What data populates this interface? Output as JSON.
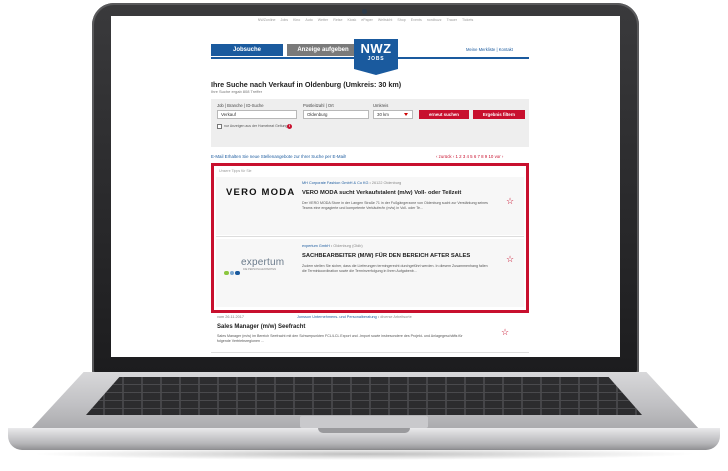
{
  "top_nav": [
    "NWZonline",
    "Jobs",
    "Kino",
    "Auto",
    "Wetter",
    "Reise",
    "Kiosk",
    "ePaper",
    "Weltsicht",
    "Shop",
    "Events",
    "nordbuzz",
    "Trauer",
    "Tickets"
  ],
  "header": {
    "jobsuche_label": "Jobsuche",
    "anzeige_label": "Anzeige aufgeben",
    "logo_main": "NWZ",
    "logo_sub": "JOBS",
    "merkliste_label": "Meine Merkliste | Kontakt"
  },
  "search": {
    "heading": "Ihre Suche nach Verkauf in Oldenburg (Umkreis: 30 km)",
    "subheading": "Ihre Suche ergab 808 Treffer",
    "job_label": "Job | Branche | ID-Suche",
    "job_value": "Verkauf",
    "location_label": "Postleitzahl | Ort",
    "location_value": "Oldenburg",
    "radius_label": "Umkreis",
    "radius_value": "30 km",
    "search_again_label": "erneut suchen",
    "filter_label": "Ergebnis filtern",
    "homeoffice_label": "nur Anzeigen aus der Homebeat Geltung",
    "info_icon_text": "i"
  },
  "results_bar": {
    "alert_link": "E-Mail Erhalten Sie neue Stellenangebote zur Ihrer Suche per E-Mail!",
    "pagination": "‹ zurück  ‹  1 2 3 4 5 6 7 8 9 10  vor  ›"
  },
  "premium": {
    "label": "Unsere Tipps für Sie",
    "cards": [
      {
        "brand": "VERO MODA",
        "company": "MH Corporate Fashion GmbH & Co KG",
        "location": "• 26122 Oldenburg",
        "title": "VERO MODA sucht Verkaufstalent (m/w) Voll- oder Teilzeit",
        "description": "Der VERO MODA Store in der Langen Straße 71 in der Fußgängerzone von Oldenburg sucht zur Verstärkung seines Teams eine engagierte und kompetente Verkäufer/in (m/w) in Voll- oder Te..."
      },
      {
        "brand": "expertum",
        "brand_tag": "DIE PERSONALEXPERTEN",
        "company": "expertum GmbH",
        "location": "• Oldenburg (Oldb)",
        "title": "SACHBEARBEITER (M/W) FÜR DEN BEREICH AFTER SALES",
        "description": "Zudem stellen Sie sicher, dass die Lieferungen termingerecht durchgeführt werden. In diesem Zusammenhang fallen die Terminkoordination sowie die Terminverfolgung in Ihren Aufgabenb..."
      }
    ]
  },
  "listing": {
    "date": "vom 26.11.2017",
    "company": "Jonsson Unternehmens- und Personalberatung",
    "location": "• diverse Arbeitsorte",
    "title": "Sales Manager (m/w) Seefracht",
    "description": "Sales Manager (m/w) im Bereich Seefracht mit den Schwerpunkten FCL/LCL Export und -Import sowie insbesondere des Projekt- und Anlagegeschäfts für folgende Vertriebsregionen ..."
  },
  "colors": {
    "brand_blue": "#1a5a9e",
    "accent_red": "#c8102e",
    "expertum_dots": [
      "#8cc63f",
      "#7aa6d0",
      "#1a5a9e",
      "#4a5a6a"
    ]
  }
}
